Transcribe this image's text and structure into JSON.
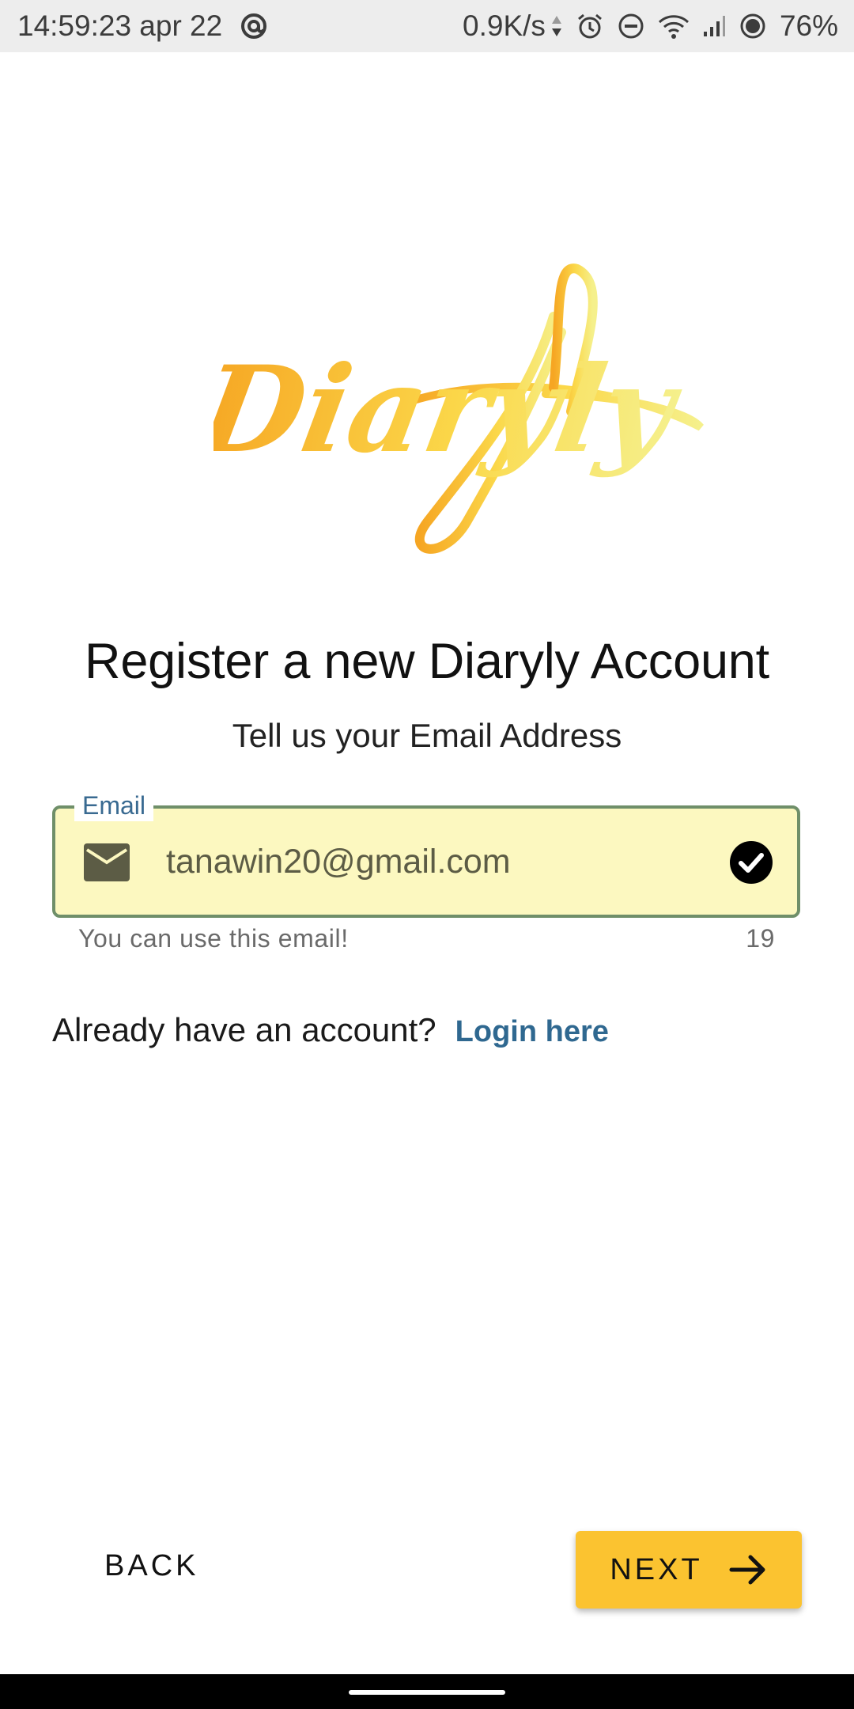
{
  "status_bar": {
    "time": "14:59:23 apr 22",
    "net_speed": "0.9K/s",
    "battery": "76%",
    "icons": [
      "at-sign-icon",
      "data-arrows-icon",
      "alarm-icon",
      "do-not-disturb-icon",
      "wifi-icon",
      "signal-icon",
      "record-dot-icon"
    ]
  },
  "logo": {
    "text": "Diaryly",
    "colors": [
      "#f6a623",
      "#fbd84a",
      "#f5f08c"
    ]
  },
  "header": {
    "title": "Register a new Diaryly Account",
    "subtitle": "Tell us your Email Address"
  },
  "email_field": {
    "label": "Email",
    "value": "tanawin20@gmail.com",
    "helper": "You can use this email!",
    "char_count": "19",
    "leading_icon": "mail-icon",
    "trailing_icon": "check-circle-icon",
    "border_color": "#6f8f69",
    "fill_color": "#fcf8c0"
  },
  "login_prompt": {
    "text": "Already have an account?",
    "link": "Login here",
    "link_color": "#2f6890"
  },
  "footer": {
    "back_label": "BACK",
    "next_label": "NEXT",
    "next_icon": "arrow-right-icon",
    "next_color": "#fbc330"
  }
}
